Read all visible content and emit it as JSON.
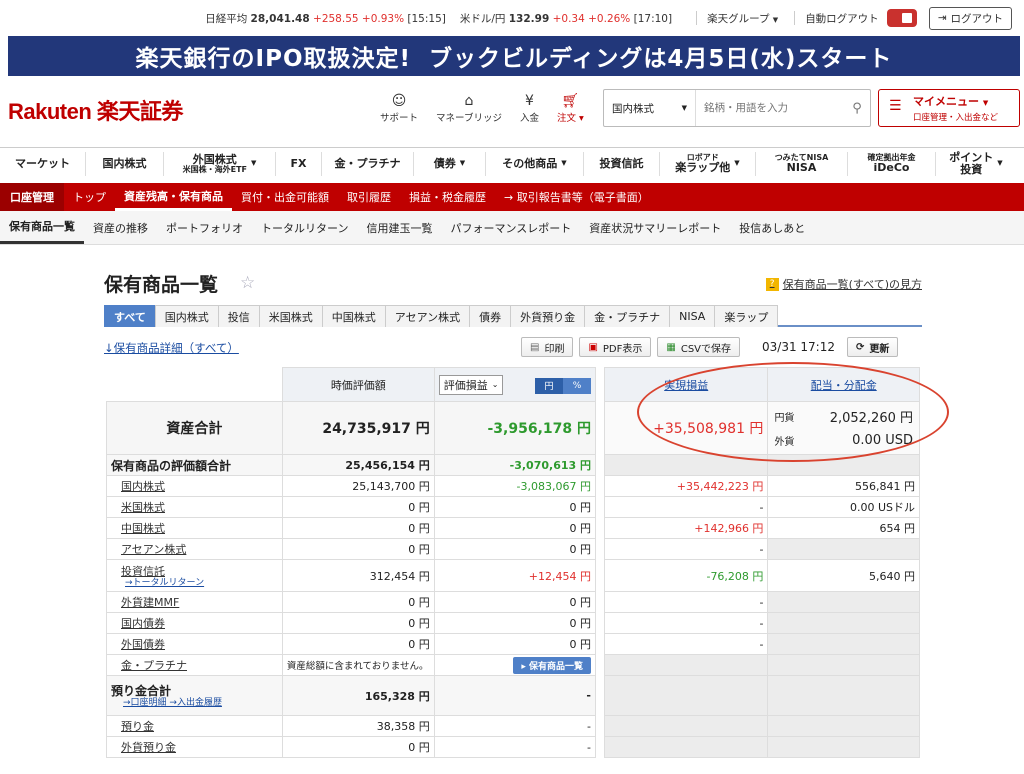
{
  "topbar": {
    "nikkei_label": "日経平均",
    "nikkei_value": "28,041.48",
    "nikkei_change": "+258.55 +0.93%",
    "nikkei_time": "[15:15]",
    "usdjpy_label": "米ドル/円",
    "usdjpy_value": "132.99",
    "usdjpy_change": "+0.34 +0.26%",
    "usdjpy_time": "[17:10]",
    "group_label": "楽天グループ",
    "auto_logout_label": "自動ログアウト",
    "logout_label": "ログアウト"
  },
  "banner": {
    "left": "楽天銀行のIPO取扱決定!",
    "right": "ブックビルディングは4月5日(水)スタート"
  },
  "header": {
    "logo": "Rakuten 楽天証券",
    "icons": [
      {
        "label": "サポート",
        "icon": "support-icon"
      },
      {
        "label": "マネーブリッジ",
        "icon": "bank-icon"
      },
      {
        "label": "入金",
        "icon": "deposit-icon"
      },
      {
        "label": "注文 ▾",
        "icon": "cart-icon"
      }
    ],
    "search_select": "国内株式",
    "search_placeholder": "銘柄・用語を入力",
    "mymenu_label": "マイメニュー",
    "mymenu_sub": "口座管理・入出金など"
  },
  "mainnav": [
    {
      "label": "マーケット"
    },
    {
      "label": "国内株式"
    },
    {
      "label": "外国株式",
      "sub": "米国株・海外ETF"
    },
    {
      "label": "FX"
    },
    {
      "label": "金・プラチナ"
    },
    {
      "label": "債券"
    },
    {
      "label": "その他商品"
    },
    {
      "label": "投資信託"
    },
    {
      "label": "楽ラップ他",
      "sub_top": "ロボアド"
    },
    {
      "label": "NISA",
      "sub_top": "つみたてNISA"
    },
    {
      "label": "iDeCo",
      "sub_top": "確定拠出年金"
    },
    {
      "label": "ポイント投資"
    }
  ],
  "redbar": {
    "title": "口座管理",
    "items": [
      "トップ",
      "資産残高・保有商品",
      "買付・出金可能額",
      "取引履歴",
      "損益・税金履歴",
      "→ 取引報告書等（電子書面）"
    ]
  },
  "subnav": [
    "保有商品一覧",
    "資産の推移",
    "ポートフォリオ",
    "トータルリターン",
    "信用建玉一覧",
    "パフォーマンスレポート",
    "資産状況サマリーレポート",
    "投信あしあと"
  ],
  "page": {
    "title": "保有商品一覧",
    "howto": "保有商品一覧(すべて)の見方",
    "tabs": [
      "すべて",
      "国内株式",
      "投信",
      "米国株式",
      "中国株式",
      "アセアン株式",
      "債券",
      "外貨預り金",
      "金・プラチナ",
      "NISA",
      "楽ラップ"
    ],
    "detail_link": "↓保有商品詳細（すべて）",
    "print": "印刷",
    "pdf": "PDF表示",
    "csv": "CSVで保存",
    "datetime": "03/31 17:12",
    "refresh": "更新"
  },
  "table": {
    "col_value": "時価評価額",
    "col_pl_select": "評価損益",
    "yen_btn": "円",
    "pct_btn": "%",
    "col_realized": "実現損益",
    "col_dividend": "配当・分配金",
    "total_label": "資産合計",
    "total_value": "24,735,917 円",
    "total_pl": "-3,956,178 円",
    "total_realized": "+35,508,981 円",
    "div_yen_label": "円貨",
    "div_yen": "2,052,260 円",
    "div_fx_label": "外貨",
    "div_fx": "0.00 USD",
    "holdings_label": "保有商品の評価額合計",
    "holdings_value": "25,456,154 円",
    "holdings_pl": "-3,070,613 円",
    "rows": [
      {
        "name": "国内株式",
        "value": "25,143,700 円",
        "pl": "-3,083,067 円",
        "realized": "+35,442,223 円",
        "div": "556,841 円"
      },
      {
        "name": "米国株式",
        "value": "0 円",
        "pl": "0 円",
        "realized": "-",
        "div": "0.00 USドル"
      },
      {
        "name": "中国株式",
        "value": "0 円",
        "pl": "0 円",
        "realized": "+142,966 円",
        "div": "654 円"
      },
      {
        "name": "アセアン株式",
        "value": "0 円",
        "pl": "0 円",
        "realized": "-",
        "div": ""
      },
      {
        "name": "投資信託",
        "sub": "→トータルリターン",
        "value": "312,454 円",
        "pl": "+12,454 円",
        "realized": "-76,208 円",
        "div": "5,640 円"
      },
      {
        "name": "外貨建MMF",
        "value": "0 円",
        "pl": "0 円",
        "realized": "-",
        "div": ""
      },
      {
        "name": "国内債券",
        "value": "0 円",
        "pl": "0 円",
        "realized": "-",
        "div": ""
      },
      {
        "name": "外国債券",
        "value": "0 円",
        "pl": "0 円",
        "realized": "-",
        "div": ""
      }
    ],
    "gold_label": "金・プラチナ",
    "gold_note": "資産総額に含まれておりません。",
    "gold_btn": "▸ 保有商品一覧",
    "deposit_label": "預り金合計",
    "deposit_links": "→口座明細 →入出金履歴",
    "deposit_value": "165,328 円",
    "deposit_pl": "-",
    "yen_dep_label": "預り金",
    "yen_dep_value": "38,358 円",
    "yen_dep_pl": "-",
    "fx_dep_label": "外貨預り金",
    "fx_dep_value": "0 円",
    "fx_dep_pl": "-"
  }
}
